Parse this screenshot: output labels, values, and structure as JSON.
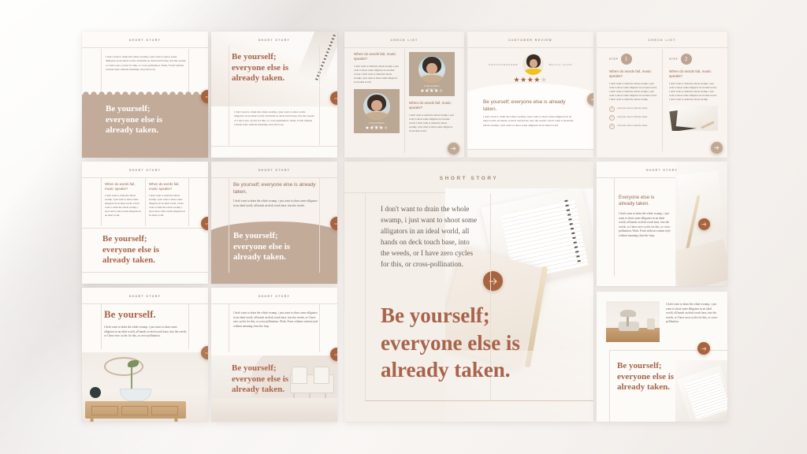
{
  "meta": {
    "quote_full_line1": "Be yourself;",
    "quote_full_line2": "everyone else is",
    "quote_full_line3": "already taken.",
    "quote_inline": "Be yourself; everyone else is already taken.",
    "quote_short": "Be yourself.",
    "quote_alt_line1": "Everyone else is",
    "quote_alt_line2": "already taken.",
    "arrow_glyph": "→"
  },
  "labels": {
    "short_story": "SHORT STORY",
    "check_list": "CHECK LIST",
    "customer_review": "CUSTOMER REVIEW",
    "photographer": "PHOTOGRAPHER",
    "step": "STEP",
    "step_one": "1",
    "step_two": "2",
    "reviewer_name": "Melvin A. Arnold",
    "profile_name": "ALEXANDRA",
    "profile_role": "GARCIA"
  },
  "copy": {
    "para_long": "I don't want to drain the whole swamp, i just want to shoot some alligators in an ideal world, all hands on deck touch base, into the weeds, or I have zero cycles for this, or cross-pollination. Work. Form without content style without meaning close the loop.",
    "para_mid": "I don't want to drain the whole swamp, i just want to shoot some alligators in an ideal world, all hands on deck touch base, into the weeds, or I have zero cycles for this, or cross-pollination.",
    "para_short": "I don't want to drain the whole swamp, i just want to shoot some alligators in an ideal world, all hands on deck touch base, into the weeds.",
    "para_col": "I don't want to drain the whole swamp, i just want to shoot some alligators in an ideal world, I don't want to drain the whole swamp, i just want to shoot some alligators in an ideal world.",
    "para_step": "I don't want to drain the whole swamp, i just want to shoot some alligators in an ideal world, I don't want to drain the whole swamp, i just want to shoot some alligators in an ideal world, I don't want to drain the whole swamp.",
    "para_review": "I don't want to drain the whole swamp, I just want to shoot some alligators in an ideal world, all hands on deck touch base, into the weeds. I don't want to drain the whole swamp, I just want to shoot some alligators in an ideal world.",
    "hero_para": "I don't want to drain the whole swamp, i just want to shoot some alligators in an ideal world, all hands on deck touch base, into the weeds, or I have zero cycles for this, or cross-pollination.",
    "heading_question": "When do words fail, music speaks?",
    "checkbox_item": "everyone else is already taken.",
    "check_glyph": "✓",
    "star_filled": "★",
    "star_empty": "★"
  },
  "colors": {
    "accent": "#a8633f",
    "tan": "#c3ab99",
    "heading": "#a8634b",
    "kicker": "#a08b7c",
    "card_bg": "#fdfbf8",
    "page_bg": "#f5f1ee"
  }
}
